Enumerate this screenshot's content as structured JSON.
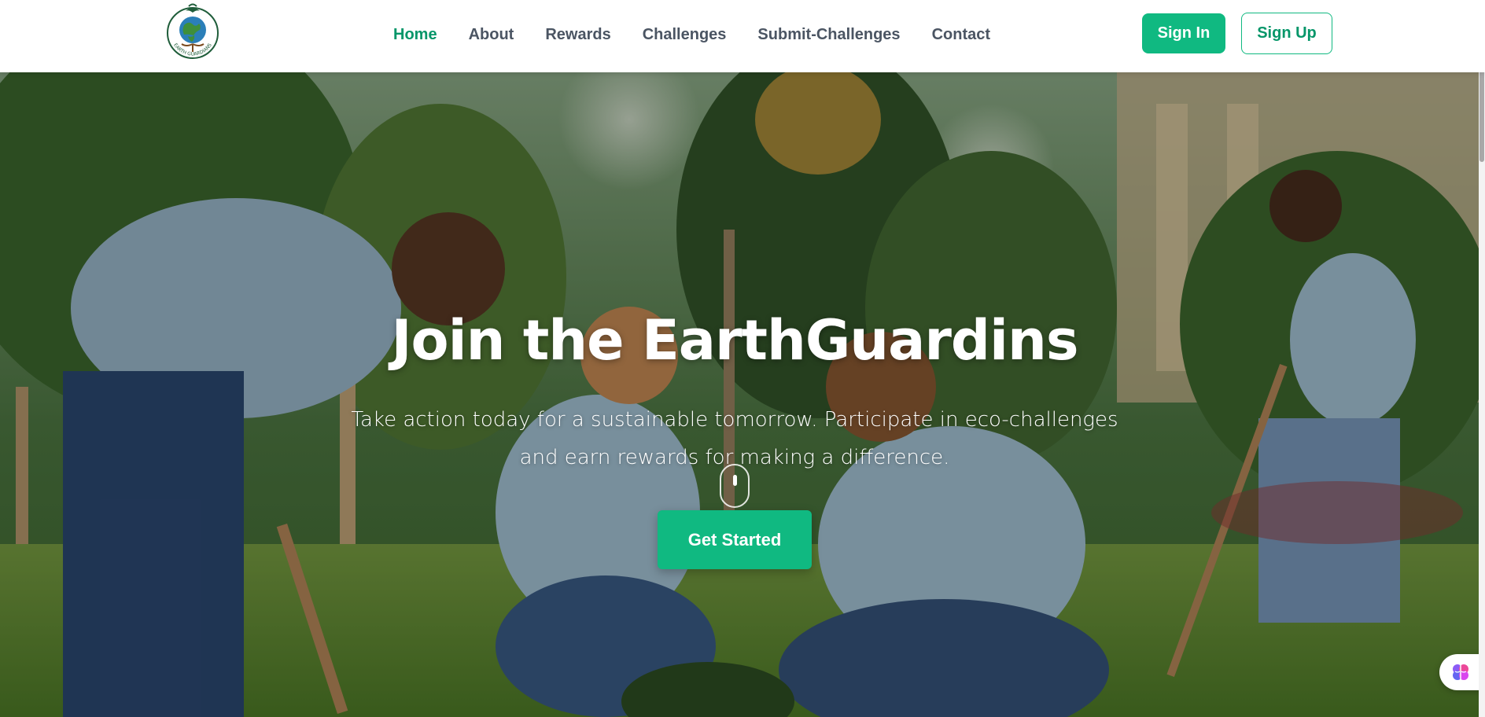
{
  "brand": {
    "name": "EarthGuardins",
    "logo_text": "EARTH GUARDIANS",
    "primary_color": "#10b981",
    "active_color": "#059669"
  },
  "nav": {
    "links": [
      {
        "label": "Home",
        "active": true
      },
      {
        "label": "About",
        "active": false
      },
      {
        "label": "Rewards",
        "active": false
      },
      {
        "label": "Challenges",
        "active": false
      },
      {
        "label": "Submit-Challenges",
        "active": false
      },
      {
        "label": "Contact",
        "active": false
      }
    ],
    "sign_in_label": "Sign In",
    "sign_up_label": "Sign Up"
  },
  "hero": {
    "title": "Join the EarthGuardins",
    "subtitle": "Take action today for a sustainable tomorrow. Participate in eco-challenges and earn rewards for making a difference.",
    "cta_label": "Get Started",
    "background_image": "volunteers-planting-trees-photo",
    "scroll_icon": "mouse-scroll-icon"
  },
  "widget": {
    "icon": "brain-icon"
  }
}
